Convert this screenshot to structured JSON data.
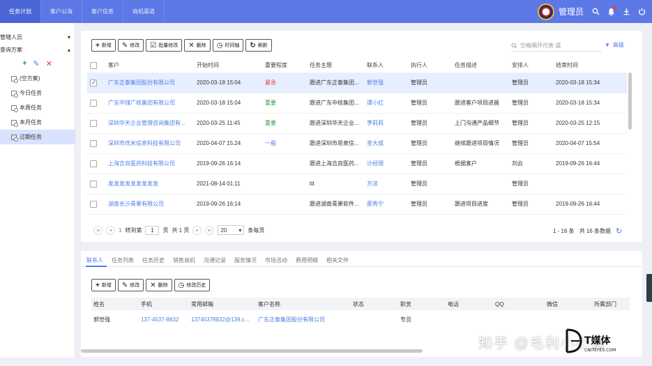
{
  "topbar": {
    "tabs": [
      "任务计划",
      "客户公海",
      "客户信息",
      "商机渠道"
    ],
    "active_tab": 0,
    "user": "管理员"
  },
  "sidebar": {
    "group1": "管辖人员",
    "group2": "查询方案",
    "items": [
      "(空方案)",
      "今日任务",
      "本周任务",
      "本月任务",
      "过期任务"
    ],
    "active_item": 4
  },
  "toolbar": {
    "add": "新增",
    "edit": "修改",
    "batch_edit": "批量修改",
    "delete": "删除",
    "timeline": "时间轴",
    "refresh": "刷新"
  },
  "search": {
    "placeholder": "空格隔开代表 或",
    "advanced": "高级"
  },
  "grid": {
    "columns": [
      "客户",
      "开始时间",
      "重要程度",
      "任务主题",
      "联系人",
      "执行人",
      "任务描述",
      "安排人",
      "结束时间"
    ],
    "rows": [
      {
        "customer": "广东正泰集团股份有限公司",
        "start": "2020-03-18 15:04",
        "priority": "紧急",
        "ptype": "urgent",
        "subject": "跟进广东正泰集团...",
        "contact": "郭世强",
        "executor": "管理员",
        "desc": "",
        "arranger": "管理员",
        "end": "2020-03-18 15:34",
        "checked": true
      },
      {
        "customer": "广东中煤广核集团有限公司",
        "start": "2020-03-18 15:04",
        "priority": "重要",
        "ptype": "important",
        "subject": "跟进广东中核集团...",
        "contact": "谭小红",
        "executor": "管理员",
        "desc": "跟进客户项目进展",
        "arranger": "管理员",
        "end": "2020-03-18 15:34",
        "checked": false
      },
      {
        "customer": "深圳华天企业管理咨询集团有...",
        "start": "2020-03-25 11:45",
        "priority": "重要",
        "ptype": "important",
        "subject": "跟进深圳华天企业...",
        "contact": "李莉莉",
        "executor": "管理员",
        "desc": "上门沟通产品细节",
        "arranger": "管理员",
        "end": "2020-03-25 12:15",
        "checked": false
      },
      {
        "customer": "深圳市优米信息科技有限公司",
        "start": "2020-04-07 15:24",
        "priority": "一般",
        "ptype": "normal",
        "subject": "跟进深圳市思泉信...",
        "contact": "金大成",
        "executor": "管理员",
        "desc": "继续跟进项目情况",
        "arranger": "管理员",
        "end": "2020-04-07 15:54",
        "checked": false
      },
      {
        "customer": "上海吉良医药科技有限公司",
        "start": "2019-09-26 16:14",
        "priority": "",
        "ptype": "",
        "subject": "跟进上海吉良医药...",
        "contact": "沙经理",
        "executor": "管理员",
        "desc": "根据客户",
        "arranger": "刘云",
        "end": "2019-09-26 16:44",
        "checked": false
      },
      {
        "customer": "发发发发发发发发发",
        "start": "2021-08-14 01:11",
        "priority": "",
        "ptype": "",
        "subject": "ttt",
        "contact": "方法",
        "executor": "管理员",
        "desc": "",
        "arranger": "管理员",
        "end": "",
        "checked": false
      },
      {
        "customer": "湖南长沙青果有限公司",
        "start": "2019-09-26 16:14",
        "priority": "",
        "ptype": "",
        "subject": "跟进湖南青果软件...",
        "contact": "廖秀宁",
        "executor": "管理员",
        "desc": "跟进项目进度",
        "arranger": "管理员",
        "end": "2019-09-26 16:44",
        "checked": false
      }
    ]
  },
  "pager": {
    "goto_label": "转到第",
    "page_value": "1",
    "page_unit": "页",
    "total_pages": "共 1 页",
    "page_size": "20",
    "per_page": "条每页",
    "range": "1 - 16 条",
    "total": "共 16 条数据"
  },
  "subtabs": [
    "联系人",
    "任务列表",
    "任务历史",
    "销售商机",
    "沟通记录",
    "服务情况",
    "市场活动",
    "费用明细",
    "相关文件"
  ],
  "toolbar2": {
    "add": "新增",
    "edit": "修改",
    "delete": "删除",
    "history": "修改历史"
  },
  "grid2": {
    "columns": [
      "姓名",
      "手机",
      "常用邮箱",
      "客户名称",
      "状态",
      "职务",
      "电话",
      "QQ",
      "微信",
      "所属部门"
    ],
    "rows": [
      {
        "name": "郭世强",
        "mobile": "137-4537-8832",
        "email": "13745378832@139.c...",
        "customer": "广东正泰集团股份有限公司",
        "status": "",
        "title": "专员",
        "phone": "",
        "qq": "",
        "wechat": "",
        "dept": ""
      }
    ]
  },
  "watermark": {
    "zhihu": "知乎 @毛利小小狼",
    "brand": "T媒体",
    "site": "CNITEYES.COM"
  }
}
